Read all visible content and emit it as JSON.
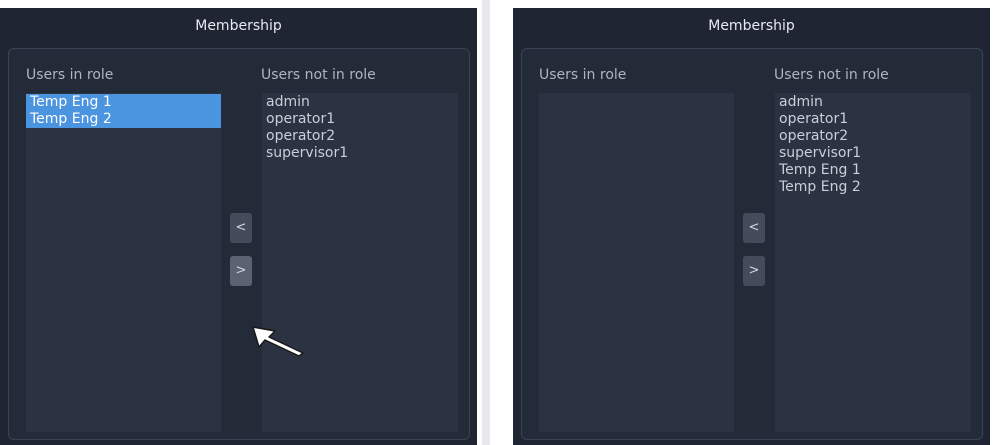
{
  "left_panel": {
    "title": "Membership",
    "users_in_role_label": "Users in role",
    "users_not_in_role_label": "Users not in role",
    "users_in_role": [
      {
        "name": "Temp Eng 1",
        "selected": true
      },
      {
        "name": "Temp Eng 2",
        "selected": true
      }
    ],
    "users_not_in_role": [
      "admin",
      "operator1",
      "operator2",
      "supervisor1"
    ],
    "add_button_label": "<",
    "remove_button_label": ">"
  },
  "right_panel": {
    "title": "Membership",
    "users_in_role_label": "Users in role",
    "users_not_in_role_label": "Users not in role",
    "users_in_role": [],
    "users_not_in_role": [
      "admin",
      "operator1",
      "operator2",
      "supervisor1",
      "Temp Eng 1",
      "Temp Eng 2"
    ],
    "add_button_label": "<",
    "remove_button_label": ">"
  },
  "colors": {
    "panel_bg": "#1f2533",
    "list_bg": "#2b3242",
    "selection": "#4a94e0",
    "button": "#444c5b"
  }
}
